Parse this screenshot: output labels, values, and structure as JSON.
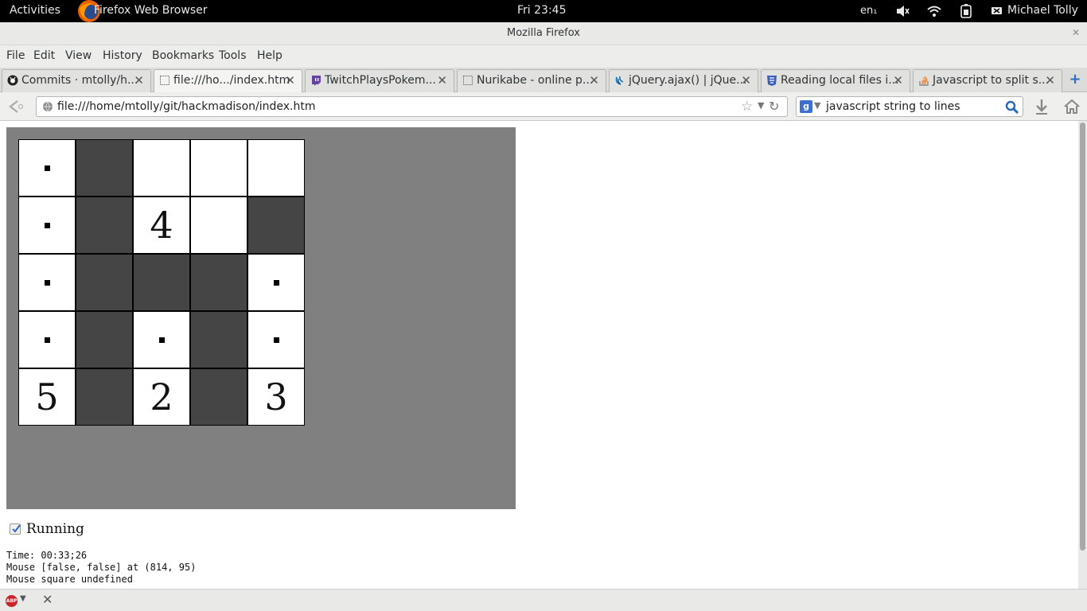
{
  "topbar": {
    "activities": "Activities",
    "app_name": "Firefox Web Browser",
    "clock": "Fri 23:45",
    "lang": "en₁",
    "user": "Michael Tolly"
  },
  "window": {
    "title": "Mozilla Firefox"
  },
  "menu": {
    "file": "File",
    "edit": "Edit",
    "view": "View",
    "history": "History",
    "bookmarks": "Bookmarks",
    "tools": "Tools",
    "help": "Help"
  },
  "tabs": [
    {
      "label": "Commits · mtolly/h...",
      "icon": "github-icon",
      "active": false
    },
    {
      "label": "file:///ho.../index.htm",
      "icon": "blank-page-icon",
      "active": true
    },
    {
      "label": "TwitchPlaysPokem...",
      "icon": "twitch-icon",
      "active": false
    },
    {
      "label": "Nurikabe - online p...",
      "icon": "blank-page-icon",
      "active": false
    },
    {
      "label": "jQuery.ajax() | jQue...",
      "icon": "jquery-icon",
      "active": false
    },
    {
      "label": "Reading local files i...",
      "icon": "html5-icon",
      "active": false
    },
    {
      "label": "Javascript to split s...",
      "icon": "stackoverflow-icon",
      "active": false
    }
  ],
  "navbar": {
    "url": "file:///home/mtolly/git/hackmadison/index.htm",
    "search_query": "javascript string to lines",
    "search_engine": "g"
  },
  "puzzle": {
    "rows": [
      [
        {
          "c": "white",
          "dot": true,
          "n": ""
        },
        {
          "c": "black",
          "dot": false,
          "n": ""
        },
        {
          "c": "white",
          "dot": false,
          "n": ""
        },
        {
          "c": "white",
          "dot": false,
          "n": ""
        },
        {
          "c": "white",
          "dot": false,
          "n": ""
        }
      ],
      [
        {
          "c": "white",
          "dot": true,
          "n": ""
        },
        {
          "c": "black",
          "dot": false,
          "n": ""
        },
        {
          "c": "white",
          "dot": false,
          "n": "4"
        },
        {
          "c": "white",
          "dot": false,
          "n": ""
        },
        {
          "c": "black",
          "dot": false,
          "n": ""
        }
      ],
      [
        {
          "c": "white",
          "dot": true,
          "n": ""
        },
        {
          "c": "black",
          "dot": false,
          "n": ""
        },
        {
          "c": "black",
          "dot": false,
          "n": ""
        },
        {
          "c": "black",
          "dot": false,
          "n": ""
        },
        {
          "c": "white",
          "dot": true,
          "n": ""
        }
      ],
      [
        {
          "c": "white",
          "dot": true,
          "n": ""
        },
        {
          "c": "black",
          "dot": false,
          "n": ""
        },
        {
          "c": "white",
          "dot": true,
          "n": ""
        },
        {
          "c": "black",
          "dot": false,
          "n": ""
        },
        {
          "c": "white",
          "dot": true,
          "n": ""
        }
      ],
      [
        {
          "c": "white",
          "dot": false,
          "n": "5"
        },
        {
          "c": "black",
          "dot": false,
          "n": ""
        },
        {
          "c": "white",
          "dot": false,
          "n": "2"
        },
        {
          "c": "black",
          "dot": false,
          "n": ""
        },
        {
          "c": "white",
          "dot": false,
          "n": "3"
        }
      ]
    ]
  },
  "running": {
    "label": "Running",
    "checked": true
  },
  "debug": {
    "time": "Time: 00:33;26",
    "mouse": "Mouse [false, false] at (814, 95)",
    "square": "Mouse square undefined"
  },
  "colors": {
    "canvas_bg": "#808080",
    "shaded_cell": "#454545",
    "accent": "#2d6cc0"
  }
}
